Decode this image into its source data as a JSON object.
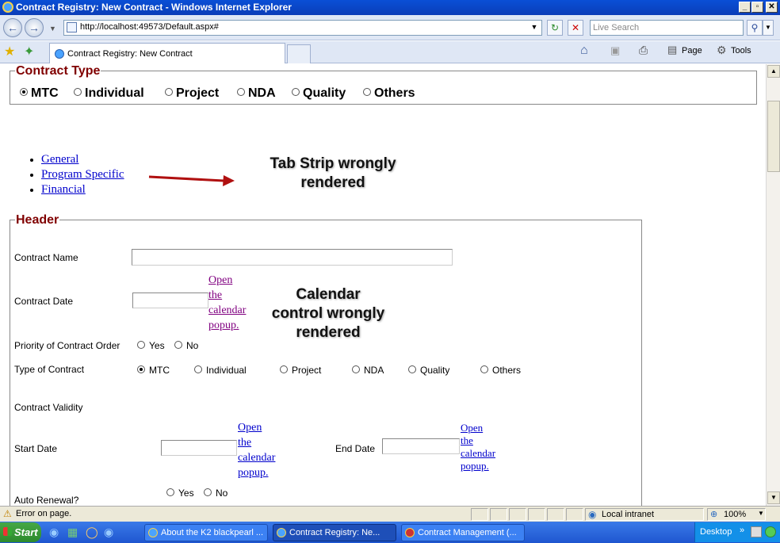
{
  "window": {
    "title": "Contract Registry: New Contract - Windows Internet Explorer",
    "minimize": "_",
    "maximize": "▫",
    "close": "✕"
  },
  "browser": {
    "url": "http://localhost:49573/Default.aspx#",
    "search_placeholder": "Live Search",
    "tab_title": "Contract Registry: New Contract",
    "toolbar": {
      "page": "Page",
      "tools": "Tools"
    }
  },
  "contract_type": {
    "legend": "Contract Type",
    "options": [
      "MTC",
      "Individual",
      "Project",
      "NDA",
      "Quality",
      "Others"
    ],
    "selected": "MTC"
  },
  "tabstrip": {
    "items": [
      "General",
      "Program Specific",
      "Financial"
    ]
  },
  "annotations": {
    "tabstrip_note_line1": "Tab Strip wrongly",
    "tabstrip_note_line2": "rendered",
    "calendar_note_line1": "Calendar",
    "calendar_note_line2": "control wrongly",
    "calendar_note_line3": "rendered"
  },
  "header": {
    "legend": "Header",
    "contract_name_label": "Contract Name",
    "contract_name_value": "",
    "contract_date_label": "Contract Date",
    "contract_date_value": "",
    "calendar_link": [
      "Open",
      "the",
      "calendar",
      "popup."
    ],
    "priority_label": "Priority of Contract Order",
    "priority_yes": "Yes",
    "priority_no": "No",
    "type_label": "Type of Contract",
    "type_options": [
      "MTC",
      "Individual",
      "Project",
      "NDA",
      "Quality",
      "Others"
    ],
    "type_selected": "MTC",
    "validity_label": "Contract Validity",
    "start_date_label": "Start Date",
    "end_date_label": "End Date",
    "auto_renewal_label": "Auto Renewal?",
    "auto_yes": "Yes",
    "auto_no": "No"
  },
  "statusbar": {
    "message": "Error on page.",
    "zone": "Local intranet",
    "zoom": "100%"
  },
  "taskbar": {
    "start": "Start",
    "tasks": [
      "About the K2 blackpearl ...",
      "Contract Registry: Ne...",
      "Contract Management (..."
    ],
    "active_task": "Contract Registry: Ne...",
    "desktop": "Desktop"
  }
}
